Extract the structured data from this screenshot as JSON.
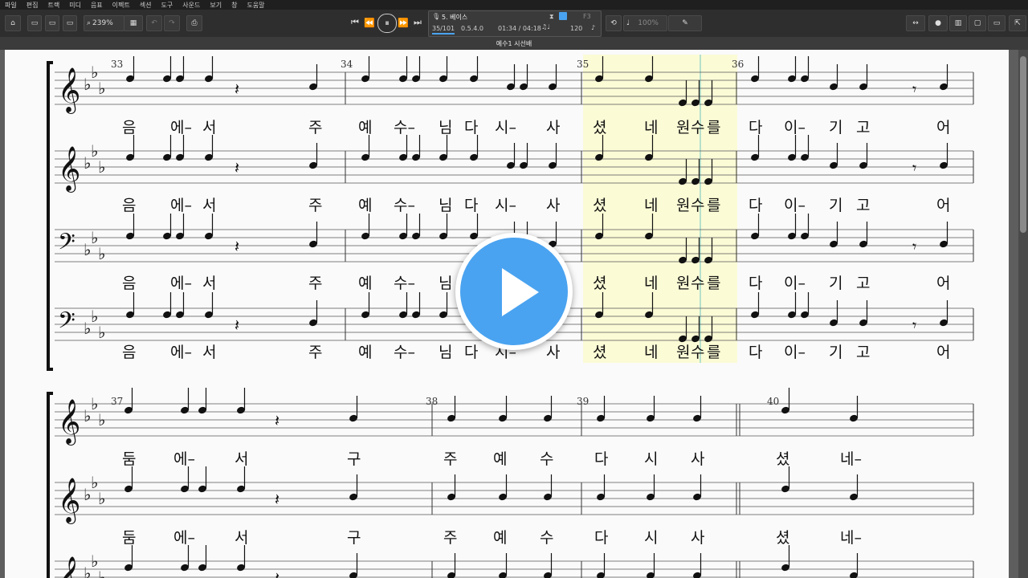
{
  "menu": [
    "파일",
    "편집",
    "트랙",
    "미디",
    "음표",
    "이펙트",
    "섹션",
    "도구",
    "사운드",
    "보기",
    "창",
    "도움말"
  ],
  "toolbar": {
    "zoom": "239%",
    "track_name": "5. 베이스",
    "position": "35/101",
    "time_sig": "0.5.4.0",
    "time": "01:34 / 04:18",
    "tempo": "120",
    "key_label": "F3",
    "volume": "100%"
  },
  "tab_title": "예수1 시선배",
  "score": {
    "system1_measures": [
      "33",
      "34",
      "35",
      "36"
    ],
    "system2_measures": [
      "37",
      "38",
      "39",
      "40"
    ],
    "staff_lyrics_s1": [
      "음",
      "에–",
      "서",
      "주",
      "예",
      "수–",
      "님",
      "다",
      "시–",
      "사",
      "셨",
      "네",
      "원",
      "수",
      "를",
      "다",
      "이–",
      "기",
      "고",
      "어"
    ],
    "staff_lyrics_s2": [
      "둠",
      "에–",
      "서",
      "구",
      "주",
      "예",
      "수",
      "다",
      "시",
      "사",
      "셨",
      "네–"
    ]
  },
  "colors": {
    "accent": "#4aa3f0",
    "highlight": "#fbfbd6",
    "page": "#fafafa",
    "toolbar": "#2e2e2e"
  }
}
